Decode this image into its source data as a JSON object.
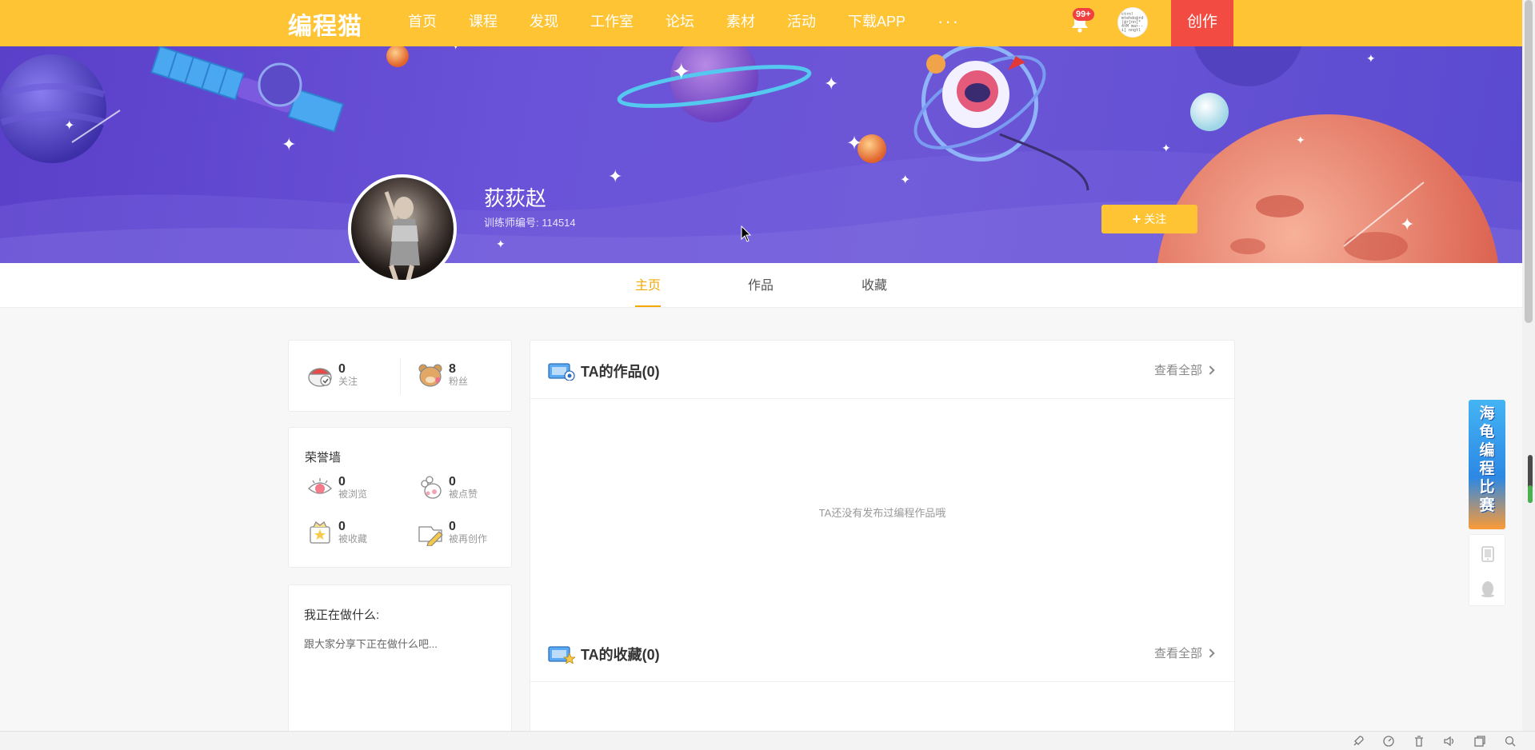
{
  "nav": {
    "logo": "编程猫",
    "items": [
      "首页",
      "课程",
      "发现",
      "工作室",
      "论坛",
      "素材",
      "活动",
      "下载APP"
    ],
    "more": "···",
    "notification_badge": "99+",
    "avatar_text": "ctrn! mtehdo@rd |@r]nn[* 4tM ma>--i] nngtl",
    "create_label": "创作"
  },
  "profile": {
    "name": "荻荻赵",
    "trainer_id": "训练师编号: 114514",
    "follow_label": "关注"
  },
  "tabs": [
    "主页",
    "作品",
    "收藏"
  ],
  "stats": {
    "following": {
      "value": "0",
      "label": "关注"
    },
    "fans": {
      "value": "8",
      "label": "粉丝"
    }
  },
  "honor": {
    "title": "荣誉墙",
    "items": [
      {
        "value": "0",
        "label": "被浏览"
      },
      {
        "value": "0",
        "label": "被点赞"
      },
      {
        "value": "0",
        "label": "被收藏"
      },
      {
        "value": "0",
        "label": "被再创作"
      }
    ]
  },
  "doing": {
    "title": "我正在做什么:",
    "placeholder": "跟大家分享下正在做什么吧..."
  },
  "works": {
    "title": "TA的作品(0)",
    "view_all": "查看全部",
    "empty": "TA还没有发布过编程作品哦"
  },
  "favorites": {
    "title": "TA的收藏(0)",
    "view_all": "查看全部"
  },
  "ad": {
    "text": "海龟编程比赛"
  },
  "colors": {
    "nav_bg": "#fec433",
    "create_bg": "#f24c42",
    "accent": "#f5a800",
    "banner_bg": "#6a53d8"
  }
}
